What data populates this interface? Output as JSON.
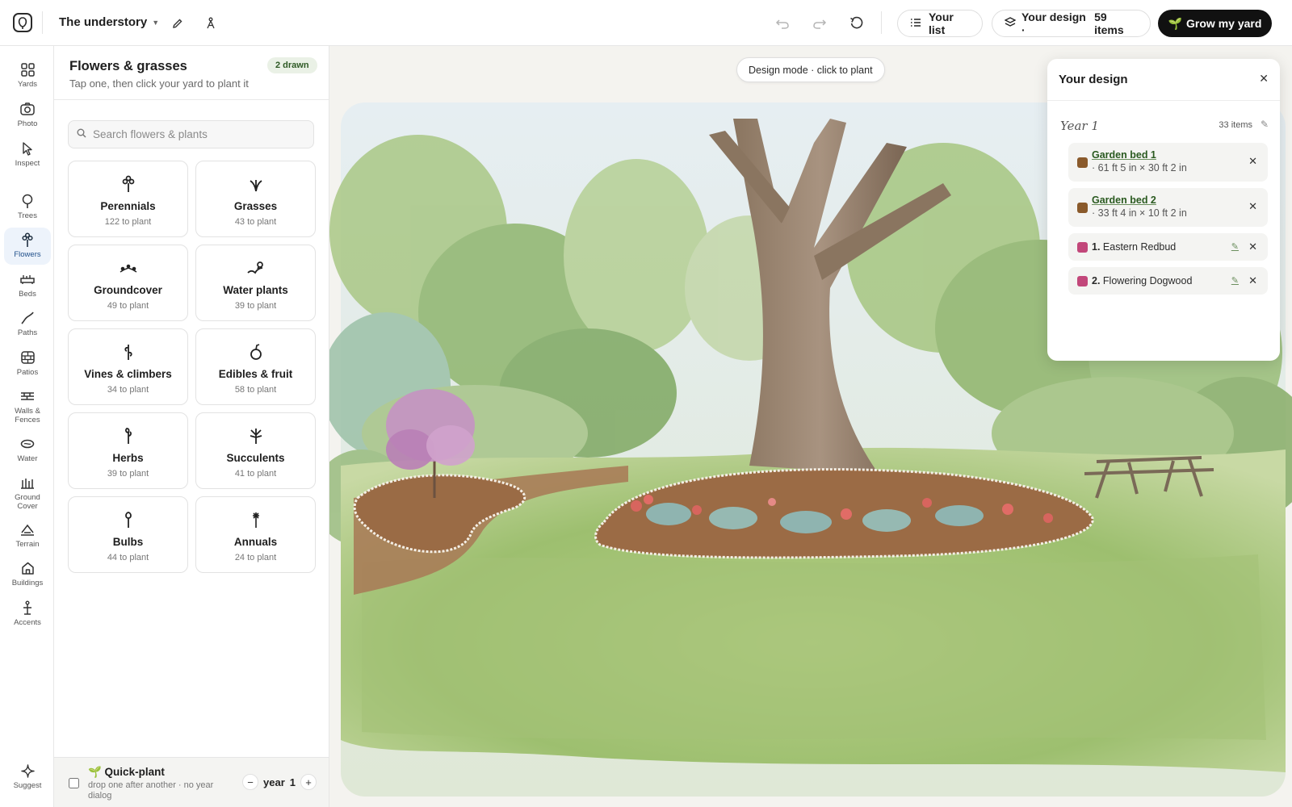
{
  "topbar": {
    "yard_name": "The understory",
    "your_list_label": "Your list",
    "your_design_label": "Your design ·",
    "your_design_count": "59 items",
    "grow_label": "Grow my yard",
    "grow_emoji": "🌱"
  },
  "rail": {
    "items": [
      {
        "label": "Yards",
        "icon": "grid-icon"
      },
      {
        "label": "Photo",
        "icon": "camera-icon"
      },
      {
        "label": "Inspect",
        "icon": "cursor-icon"
      },
      {
        "label": "Trees",
        "icon": "tree-icon"
      },
      {
        "label": "Flowers",
        "icon": "flower-icon",
        "active": true
      },
      {
        "label": "Beds",
        "icon": "bed-icon"
      },
      {
        "label": "Paths",
        "icon": "path-icon"
      },
      {
        "label": "Patios",
        "icon": "patio-icon"
      },
      {
        "label": "Walls & Fences",
        "icon": "fence-icon"
      },
      {
        "label": "Water",
        "icon": "water-icon"
      },
      {
        "label": "Ground Cover",
        "icon": "groundcover-icon"
      },
      {
        "label": "Terrain",
        "icon": "terrain-icon"
      },
      {
        "label": "Buildings",
        "icon": "house-icon"
      },
      {
        "label": "Accents",
        "icon": "accent-icon"
      }
    ],
    "suggest_label": "Suggest"
  },
  "panel": {
    "title": "Flowers & grasses",
    "subtitle": "Tap one, then click your yard to plant it",
    "badge": "2 drawn",
    "search_placeholder": "Search flowers & plants",
    "categories": [
      {
        "name": "Perennials",
        "count": "122 to plant",
        "icon": "perennial-icon"
      },
      {
        "name": "Grasses",
        "count": "43 to plant",
        "icon": "grass-icon"
      },
      {
        "name": "Groundcover",
        "count": "49 to plant",
        "icon": "groundcover-icon"
      },
      {
        "name": "Water plants",
        "count": "39 to plant",
        "icon": "water-plant-icon"
      },
      {
        "name": "Vines & climbers",
        "count": "34 to plant",
        "icon": "vine-icon"
      },
      {
        "name": "Edibles & fruit",
        "count": "58 to plant",
        "icon": "fruit-icon"
      },
      {
        "name": "Herbs",
        "count": "39 to plant",
        "icon": "herb-icon"
      },
      {
        "name": "Succulents",
        "count": "41 to plant",
        "icon": "succulent-icon"
      },
      {
        "name": "Bulbs",
        "count": "44 to plant",
        "icon": "bulb-icon"
      },
      {
        "name": "Annuals",
        "count": "24 to plant",
        "icon": "annual-icon"
      }
    ],
    "quick": {
      "title": "🌱 Quick-plant",
      "subtitle": "drop one after another · no year dialog",
      "year_word": "year",
      "year_value": "1"
    }
  },
  "canvas": {
    "mode_label": "Design mode · click to plant"
  },
  "design": {
    "title": "Your design",
    "year_label": "Year 1",
    "year_count": "33 items",
    "beds": [
      {
        "name": "Garden bed 1",
        "dims": "· 61 ft 5 in × 30 ft 2 in",
        "color": "#8a5a2b"
      },
      {
        "name": "Garden bed 2",
        "dims": "· 33 ft 4 in × 10 ft 2 in",
        "color": "#8a5a2b"
      }
    ],
    "plants": [
      {
        "num": "1.",
        "name": "Eastern Redbud",
        "color": "#c2477a"
      },
      {
        "num": "2.",
        "name": "Flowering Dogwood",
        "color": "#c2477a"
      }
    ]
  }
}
